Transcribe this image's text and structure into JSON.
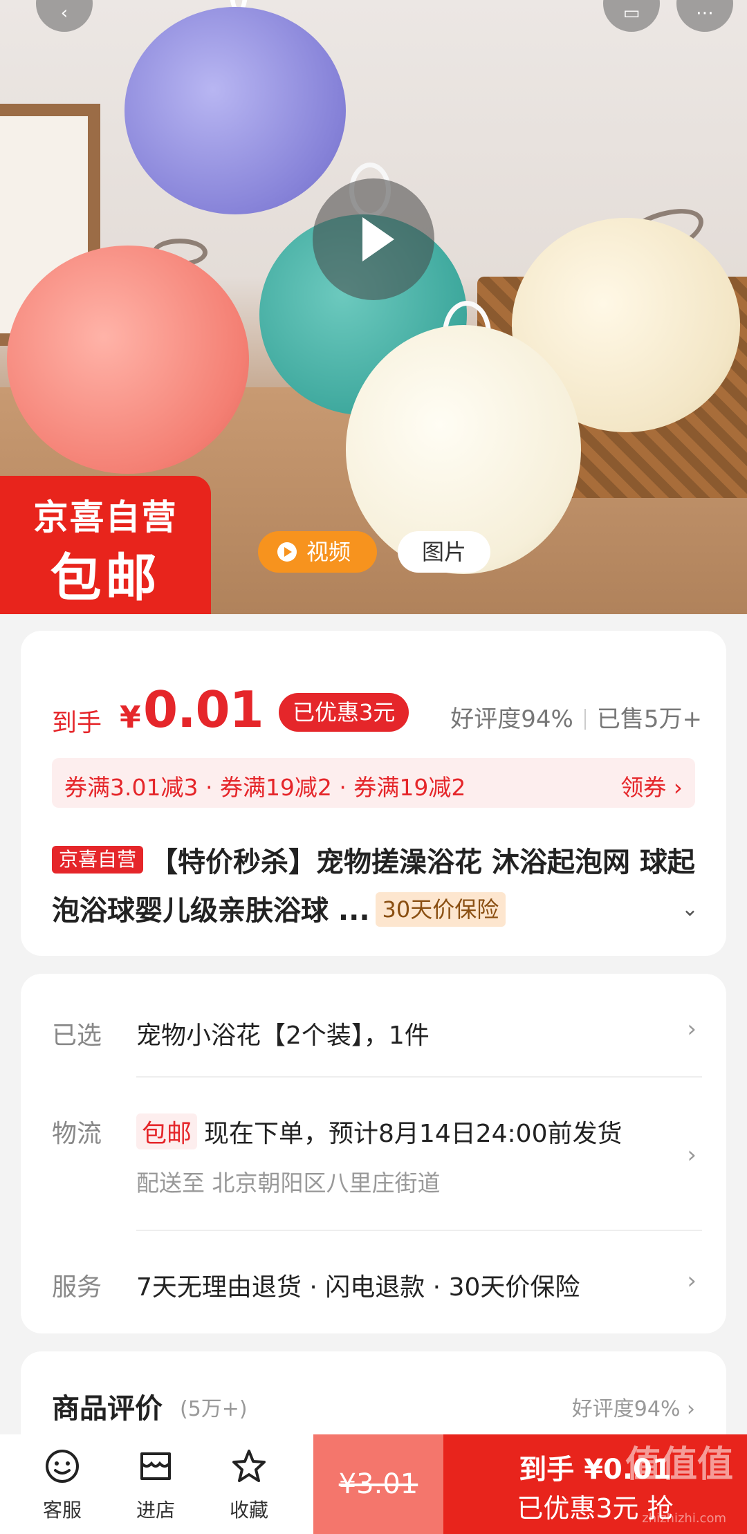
{
  "hero": {
    "badge_line1": "京喜自营",
    "badge_line2": "包邮",
    "tab_video": "视频",
    "tab_image": "图片"
  },
  "price": {
    "prefix": "到手",
    "currency": "¥",
    "value": "0.01",
    "discount_pill": "已优惠3元",
    "rating": "好评度94%",
    "sold": "已售5万+"
  },
  "coupon": {
    "text": "券满3.01减3 · 券满19减2 · 券满19减2",
    "action": "领券"
  },
  "product": {
    "tag": "京喜自营",
    "title": "【特价秒杀】宠物搓澡浴花 沐浴起泡网 球起泡浴球婴儿级亲肤浴球 ...",
    "price_protect_tag": "30天价保险"
  },
  "details": {
    "selected_label": "已选",
    "selected_value": "宠物小浴花【2个装】，1件",
    "logistics_label": "物流",
    "free_shipping_tag": "包邮",
    "logistics_value": "现在下单，预计8月14日24:00前发货",
    "delivery_to": "配送至  北京朝阳区八里庄街道",
    "service_label": "服务",
    "service_value": "7天无理由退货 · 闪电退款 · 30天价保险"
  },
  "reviews": {
    "title": "商品评价",
    "count": "(5万+)",
    "rate": "好评度94%"
  },
  "bottom": {
    "cs_label": "客服",
    "store_label": "进店",
    "fav_label": "收藏",
    "original_price": "¥3.01",
    "buy_line1": "到手 ¥0.01",
    "buy_line2": "已优惠3元 抢"
  },
  "watermark": {
    "text": "值值值",
    "sub": "zhizhizhi.com"
  },
  "colors": {
    "accent_red": "#e5262a",
    "buy_red": "#e8241c",
    "orig_price_bg": "#f4766c",
    "video_tab": "#f7931e"
  },
  "icons": [
    "back-icon",
    "cart-icon",
    "more-icon",
    "play-icon",
    "chevron-right-icon",
    "chevron-down-icon",
    "customer-service-icon",
    "store-icon",
    "star-icon"
  ]
}
